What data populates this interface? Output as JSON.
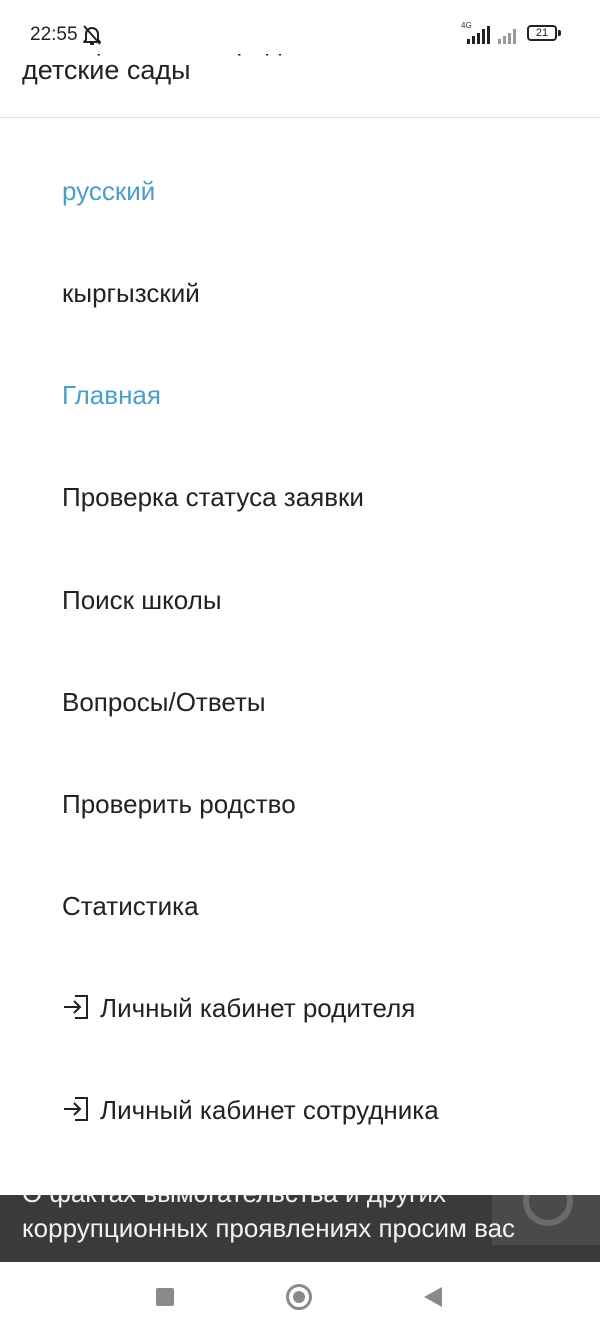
{
  "status_bar": {
    "time": "22:55",
    "network_label": "4G",
    "battery": "21",
    "icons": [
      "mute-bell-icon",
      "signal-icon",
      "signal-icon",
      "battery-icon"
    ]
  },
  "header": {
    "title_clipped": "Электронная очередь в",
    "title": "детские сады"
  },
  "menu": {
    "accent_color": "#4a9fc8",
    "items": [
      {
        "label": "русский",
        "active": true
      },
      {
        "label": "кыргызский",
        "active": false
      },
      {
        "label": "Главная",
        "active": true
      },
      {
        "label": "Проверка статуса заявки",
        "active": false
      },
      {
        "label": "Поиск школы",
        "active": false
      },
      {
        "label": "Вопросы/Ответы",
        "active": false
      },
      {
        "label": "Проверить родство",
        "active": false
      },
      {
        "label": "Статистика",
        "active": false
      },
      {
        "label": "Личный кабинет родителя",
        "active": false,
        "icon": "login-icon"
      },
      {
        "label": "Личный кабинет сотрудника",
        "active": false,
        "icon": "login-icon"
      }
    ]
  },
  "notice": {
    "line_top": "О фактах вымогательства и других",
    "line": "коррупционных проявлениях просим вас"
  },
  "nav_bar": {
    "icons": [
      "recents-icon",
      "home-icon",
      "back-icon"
    ]
  }
}
